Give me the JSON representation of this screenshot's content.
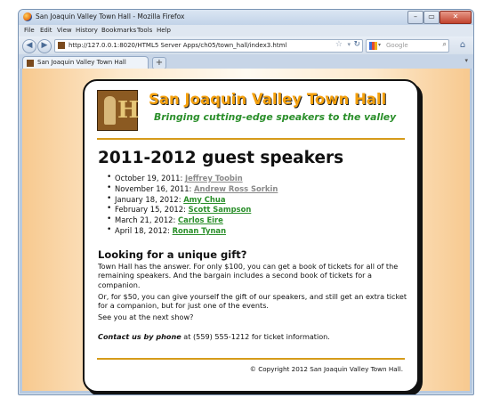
{
  "window": {
    "title": "San Joaquin Valley Town Hall - Mozilla Firefox",
    "controls": {
      "minimize": "–",
      "maximize": "▭",
      "close": "✕"
    }
  },
  "menu": [
    "File",
    "Edit",
    "View",
    "History",
    "Bookmarks",
    "Tools",
    "Help"
  ],
  "nav": {
    "url": "http://127.0.0.1:8020/HTML5 Server Apps/ch05/town_hall/index3.html",
    "search_placeholder": "Google",
    "back_icon": "back-arrow-icon",
    "forward_icon": "forward-arrow-icon"
  },
  "tabs": [
    {
      "label": "San Joaquin Valley Town Hall"
    }
  ],
  "page": {
    "brand": "San Joaquin Valley Town Hall",
    "tagline": "Bringing cutting-edge speakers to the valley",
    "heading": "2011-2012 guest speakers",
    "speakers": [
      {
        "date": "October 19, 2011: ",
        "name": "Jeffrey Toobin",
        "visited": true
      },
      {
        "date": "November 16, 2011: ",
        "name": "Andrew Ross Sorkin",
        "visited": true
      },
      {
        "date": "January 18, 2012: ",
        "name": "Amy Chua",
        "visited": false
      },
      {
        "date": "February 15, 2012: ",
        "name": "Scott Sampson",
        "visited": false
      },
      {
        "date": "March 21, 2012: ",
        "name": "Carlos Eire",
        "visited": false
      },
      {
        "date": "April 18, 2012: ",
        "name": "Ronan Tynan",
        "visited": false
      }
    ],
    "gift_heading": "Looking for a unique gift?",
    "gift_p1": "Town Hall has the answer. For only $100, you can get a book of tickets for all of the remaining speakers. And the bargain includes a second book of tickets for a companion.",
    "gift_p2": "Or, for $50, you can give yourself the gift of our speakers, and still get an extra ticket for a companion, but for just one of the events.",
    "gift_p3": "See you at the next show?",
    "contact_label": "Contact us by phone",
    "contact_rest": " at (559) 555-1212 for ticket information.",
    "footer": "© Copyright 2012 San Joaquin Valley Town Hall."
  },
  "colors": {
    "brand": "#f5a10e",
    "tagline": "#2b8f2b",
    "rule": "#d69b1a",
    "visited_link": "#8a8a8a",
    "link": "#2b8f2b"
  }
}
